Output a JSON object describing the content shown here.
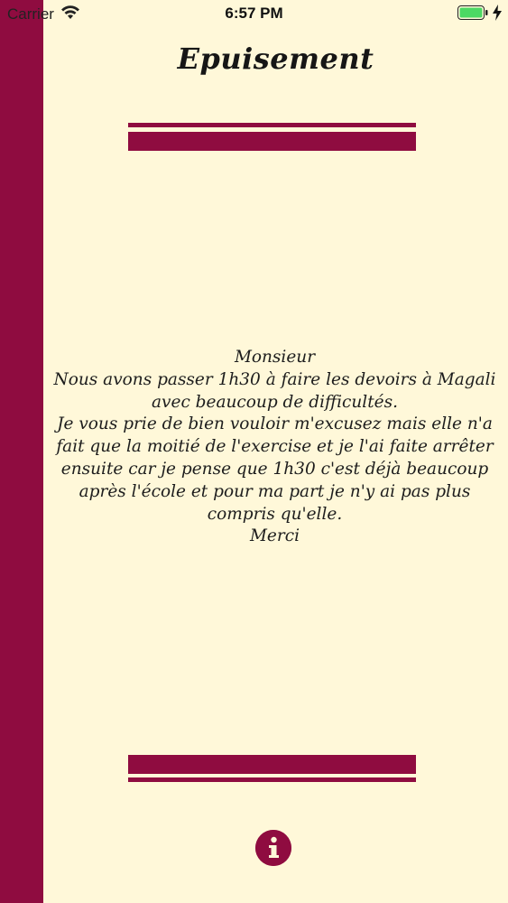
{
  "status_bar": {
    "carrier": "Carrier",
    "time": "6:57 PM",
    "icons": [
      "wifi-icon",
      "battery-icon",
      "charging-bolt-icon"
    ]
  },
  "page": {
    "title": "Epuisement"
  },
  "message": {
    "lines": [
      "Monsieur",
      "Nous avons passer 1h30 à faire les devoirs à Magali avec beaucoup de difficultés.",
      "Je vous prie de bien vouloir m'excusez mais elle n'a fait que la moitié de l'exercise et je l'ai faite arrêter ensuite car je pense que 1h30 c'est déjà beaucoup après l'école et pour ma part je n'y ai pas plus compris qu'elle.",
      "Merci"
    ]
  },
  "footer": {
    "info_icon": "info-icon"
  },
  "colors": {
    "background": "#fff8d9",
    "accent": "#8f0c40",
    "text": "#1d1d1d",
    "battery": "#4cd964"
  }
}
